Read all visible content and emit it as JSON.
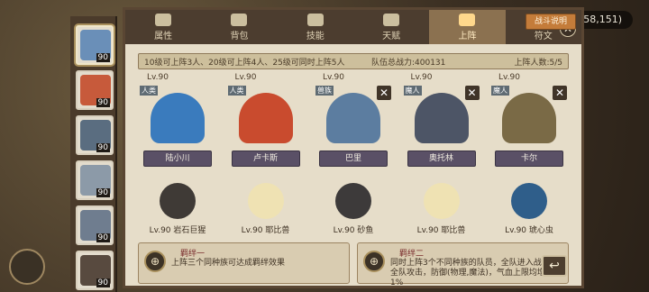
{
  "top_bar": {
    "coords": "(158,151)"
  },
  "tabs": [
    {
      "label": "属性",
      "icon": "attribute-icon"
    },
    {
      "label": "背包",
      "icon": "bag-icon"
    },
    {
      "label": "技能",
      "icon": "skill-book-icon"
    },
    {
      "label": "天赋",
      "icon": "talent-eye-icon"
    },
    {
      "label": "上阵",
      "icon": "lineup-swords-icon"
    },
    {
      "label": "符文",
      "icon": "rune-icon"
    }
  ],
  "active_tab": "上阵",
  "info": {
    "rule": "10级可上阵3人、20级可上阵4人、25级可同时上阵5人",
    "power": "队伍总战力:400131",
    "count": "上阵人数:5/5"
  },
  "sidebar": {
    "slots": [
      {
        "lv": "90",
        "color": "#6a8fb8"
      },
      {
        "lv": "90",
        "color": "#c75a3b"
      },
      {
        "lv": "90",
        "color": "#5a6d80"
      },
      {
        "lv": "90",
        "color": "#8c9aa8"
      },
      {
        "lv": "90",
        "color": "#6f7d8f"
      },
      {
        "lv": "90",
        "color": "#584a3f"
      }
    ]
  },
  "heroes": [
    {
      "lvl": "Lv.90",
      "tag": "人类",
      "name": "陆小川",
      "color": "#3a7bbd",
      "removable": false
    },
    {
      "lvl": "Lv.90",
      "tag": "人类",
      "name": "卢卡斯",
      "color": "#c94b2e",
      "removable": false
    },
    {
      "lvl": "Lv.90",
      "tag": "兽族",
      "name": "巴里",
      "color": "#5c7da0",
      "removable": true
    },
    {
      "lvl": "Lv.90",
      "tag": "魔人",
      "name": "奥托林",
      "color": "#4d5566",
      "removable": true
    },
    {
      "lvl": "Lv.90",
      "tag": "魔人",
      "name": "卡尔",
      "color": "#7a6a46",
      "removable": true
    }
  ],
  "pets": [
    {
      "name": "Lv.90 岩石巨猩",
      "color": "#3f3a36"
    },
    {
      "name": "Lv.90 耶比兽",
      "color": "#efe2b3"
    },
    {
      "name": "Lv.90 砂鱼",
      "color": "#3d3a3a"
    },
    {
      "name": "Lv.90 耶比兽",
      "color": "#efe2b3"
    },
    {
      "name": "Lv.90 琥心虫",
      "color": "#2f5e8a"
    }
  ],
  "bonds": [
    {
      "title": "羁绊一",
      "desc": "上阵三个同种族可达成羁绊效果",
      "symbol": "⊕"
    },
    {
      "title": "羁绊二",
      "desc": "同时上阵3个不同种族的队员，全队进入战斗后全队攻击，防御(物理,魔法)，气血上限均增加1%",
      "symbol": "⊕"
    }
  ],
  "buttons": {
    "battle_info": "战斗说明",
    "close": "✕",
    "back": "↩"
  }
}
